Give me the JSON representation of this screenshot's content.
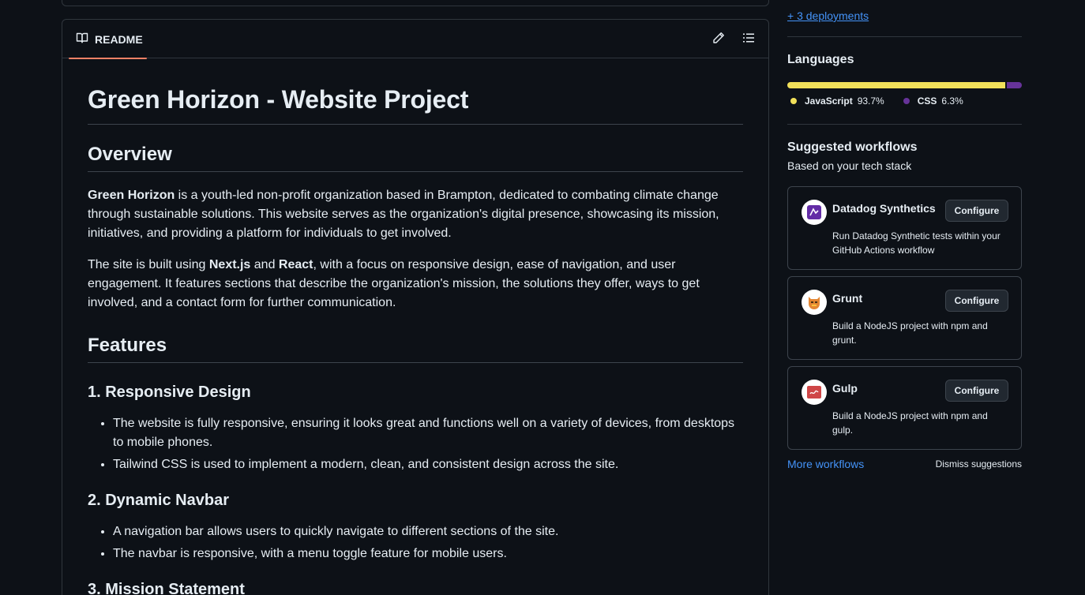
{
  "readme": {
    "tab_label": "README",
    "title": "Green Horizon - Website Project",
    "overview_heading": "Overview",
    "overview_p1_bold": "Green Horizon",
    "overview_p1_rest": " is a youth-led non-profit organization based in Brampton, dedicated to combating climate change through sustainable solutions. This website serves as the organization's digital presence, showcasing its mission, initiatives, and providing a platform for individuals to get involved.",
    "overview_p2_a": "The site is built using ",
    "overview_p2_nextjs": "Next.js",
    "overview_p2_and": " and ",
    "overview_p2_react": "React",
    "overview_p2_rest": ", with a focus on responsive design, ease of navigation, and user engagement. It features sections that describe the organization's mission, the solutions they offer, ways to get involved, and a contact form for further communication.",
    "features_heading": "Features",
    "feature1_heading": "1. Responsive Design",
    "feature1_items": [
      "The website is fully responsive, ensuring it looks great and functions well on a variety of devices, from desktops to mobile phones.",
      "Tailwind CSS is used to implement a modern, clean, and consistent design across the site."
    ],
    "feature2_heading": "2. Dynamic Navbar",
    "feature2_items": [
      "A navigation bar allows users to quickly navigate to different sections of the site.",
      "The navbar is responsive, with a menu toggle feature for mobile users."
    ],
    "feature3_heading": "3. Mission Statement"
  },
  "sidebar": {
    "deployments_link": "+ 3 deployments",
    "languages_heading": "Languages",
    "languages": [
      {
        "name": "JavaScript",
        "percent_label": "93.7%",
        "percent": 93.7,
        "color": "#f1e05a"
      },
      {
        "name": "CSS",
        "percent_label": "6.3%",
        "percent": 6.3,
        "color": "#663399"
      }
    ],
    "workflows_heading": "Suggested workflows",
    "workflows_sub": "Based on your tech stack",
    "workflows": [
      {
        "name": "Datadog Synthetics",
        "description": "Run Datadog Synthetic tests within your GitHub Actions workflow",
        "button": "Configure",
        "icon": "datadog-logo-icon"
      },
      {
        "name": "Grunt",
        "description": "Build a NodeJS project with npm and grunt.",
        "button": "Configure",
        "icon": "grunt-logo-icon"
      },
      {
        "name": "Gulp",
        "description": "Build a NodeJS project with npm and gulp.",
        "button": "Configure",
        "icon": "gulp-logo-icon"
      }
    ],
    "more_workflows": "More workflows",
    "dismiss": "Dismiss suggestions"
  },
  "colors": {
    "background": "#0d1117",
    "border": "#30363d",
    "link": "#4493f8",
    "tab_underline": "#f78166"
  }
}
